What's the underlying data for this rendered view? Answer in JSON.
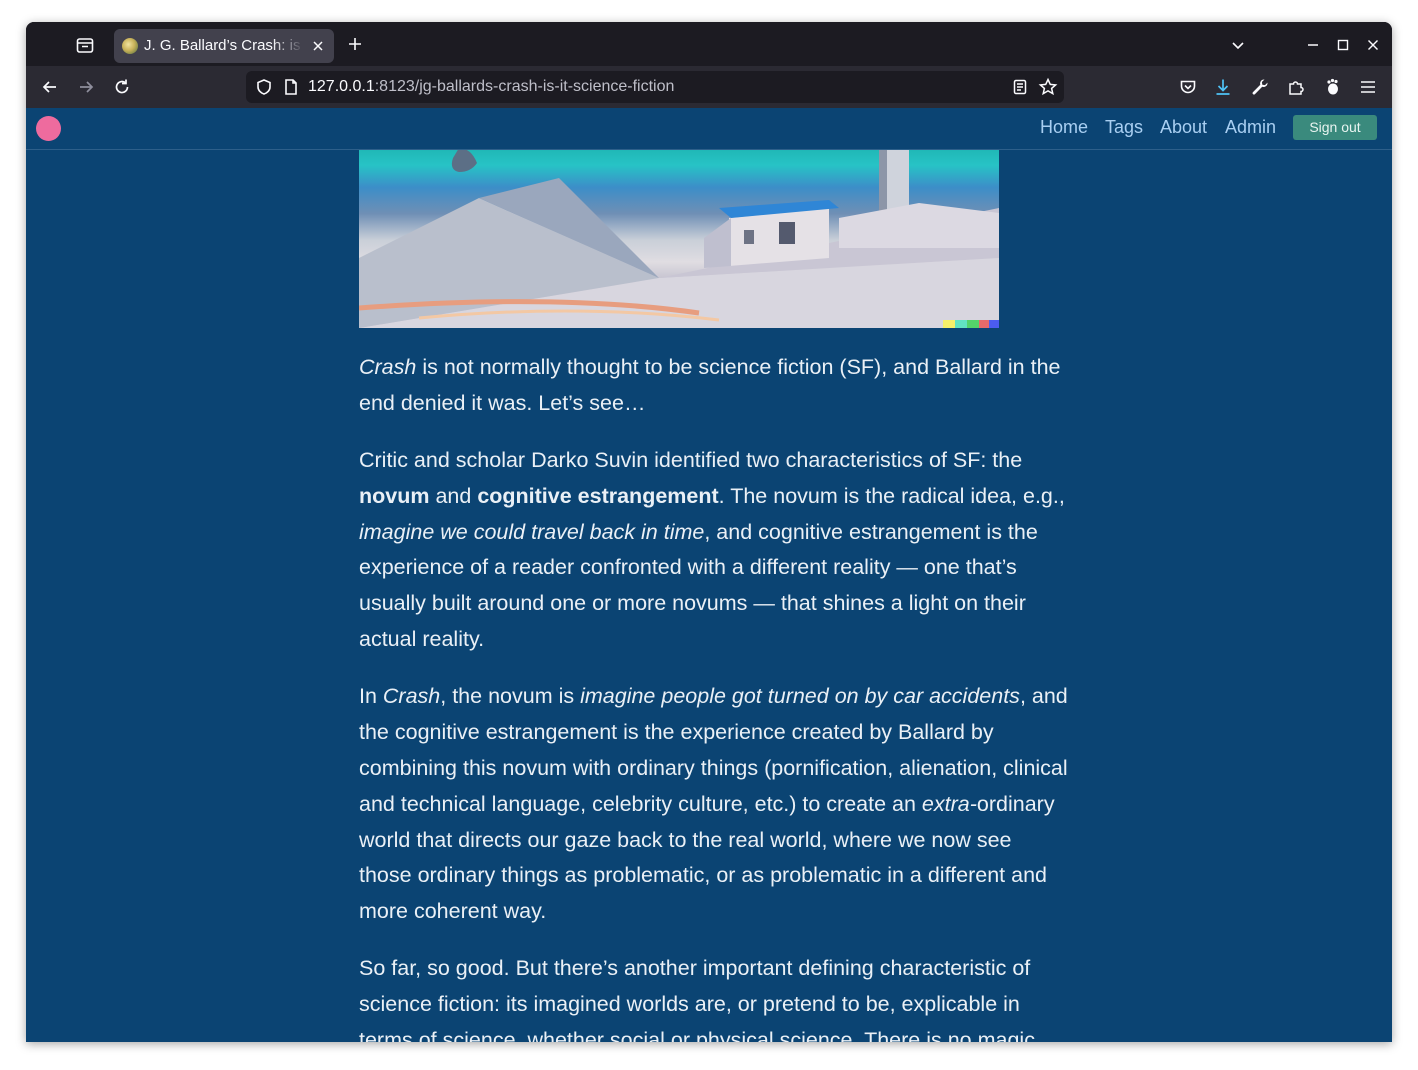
{
  "browser": {
    "tab": {
      "title": "J. G. Ballard’s Crash: is it science fiction?"
    },
    "url": {
      "host": "127.0.0.1",
      "rest": ":8123/jg-ballards-crash-is-it-science-fiction"
    }
  },
  "site": {
    "nav": {
      "home": "Home",
      "tags": "Tags",
      "about": "About",
      "admin": "Admin",
      "sign_out": "Sign out"
    },
    "accent_colors": {
      "background": "#0b4473",
      "logo": "#ee6b9e",
      "link": "#a9cff2",
      "button": "#3a8a7d"
    }
  },
  "article": {
    "p1": {
      "a": "Crash",
      "b": " is not normally thought to be science fiction (SF), and Ballard in the end denied it was. Let’s see…"
    },
    "p2": {
      "a": "Critic and scholar Darko Suvin identified two characteristics of SF: the ",
      "b": "novum",
      "c": " and ",
      "d": "cognitive estrangement",
      "e": ". The novum is the radical idea, e.g., ",
      "f": "imagine we could travel back in time",
      "g": ", and cognitive estrangement is the experience of a reader confronted with a different reality — one that’s usually built around one or more novums — that shines a light on their actual reality."
    },
    "p3": {
      "a": "In ",
      "b": "Crash",
      "c": ", the novum is ",
      "d": "imagine people got turned on by car accidents",
      "e": ", and the cognitive estrangement is the experience created by Ballard by combining this novum with ordinary things (pornification, alienation, clinical and technical language, celebrity culture, etc.) to create an ",
      "f": "extra-",
      "g": "ordinary world that directs our gaze back to the real world, where we now see those ordinary things as problematic, or as problematic in a different and more coherent way."
    },
    "p4": {
      "a": "So far, so good. But there’s another important defining characteristic of science fiction: its imagined worlds are, or pretend to be, explicable in terms of science, whether social or physical science. There is no magic"
    }
  }
}
